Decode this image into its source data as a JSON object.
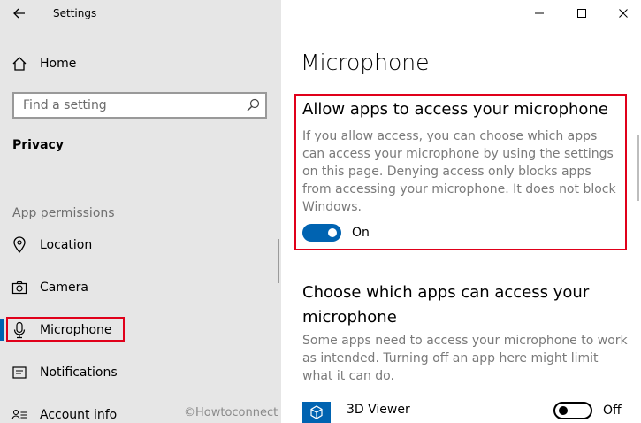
{
  "window": {
    "title": "Settings",
    "minimize_icon": "minimize-icon",
    "maximize_icon": "maximize-icon",
    "close_icon": "close-icon"
  },
  "sidebar": {
    "home_label": "Home",
    "search_placeholder": "Find a setting",
    "section_title": "Privacy",
    "group_label": "App permissions",
    "items": [
      {
        "label": "Location",
        "icon": "location-icon"
      },
      {
        "label": "Camera",
        "icon": "camera-icon"
      },
      {
        "label": "Microphone",
        "icon": "microphone-icon",
        "selected": true
      },
      {
        "label": "Notifications",
        "icon": "notifications-icon"
      },
      {
        "label": "Account info",
        "icon": "account-info-icon"
      }
    ]
  },
  "main": {
    "page_title": "Microphone",
    "allow": {
      "heading": "Allow apps to access your microphone",
      "description": "If you allow access, you can choose which apps can access your microphone by using the settings on this page. Denying access only blocks apps from accessing your microphone. It does not block Windows.",
      "toggle_state": "On"
    },
    "choose": {
      "heading": "Choose which apps can access your microphone",
      "description": "Some apps need to access your microphone to work as intended. Turning off an app here might limit what it can do."
    },
    "apps": [
      {
        "name": "3D Viewer",
        "state": "Off",
        "icon": "3d-viewer-icon"
      }
    ]
  },
  "watermark": "©Howtoconnect",
  "colors": {
    "accent": "#0063b1",
    "highlight": "#e0001a",
    "sidebar_bg": "#e6e6e6"
  }
}
